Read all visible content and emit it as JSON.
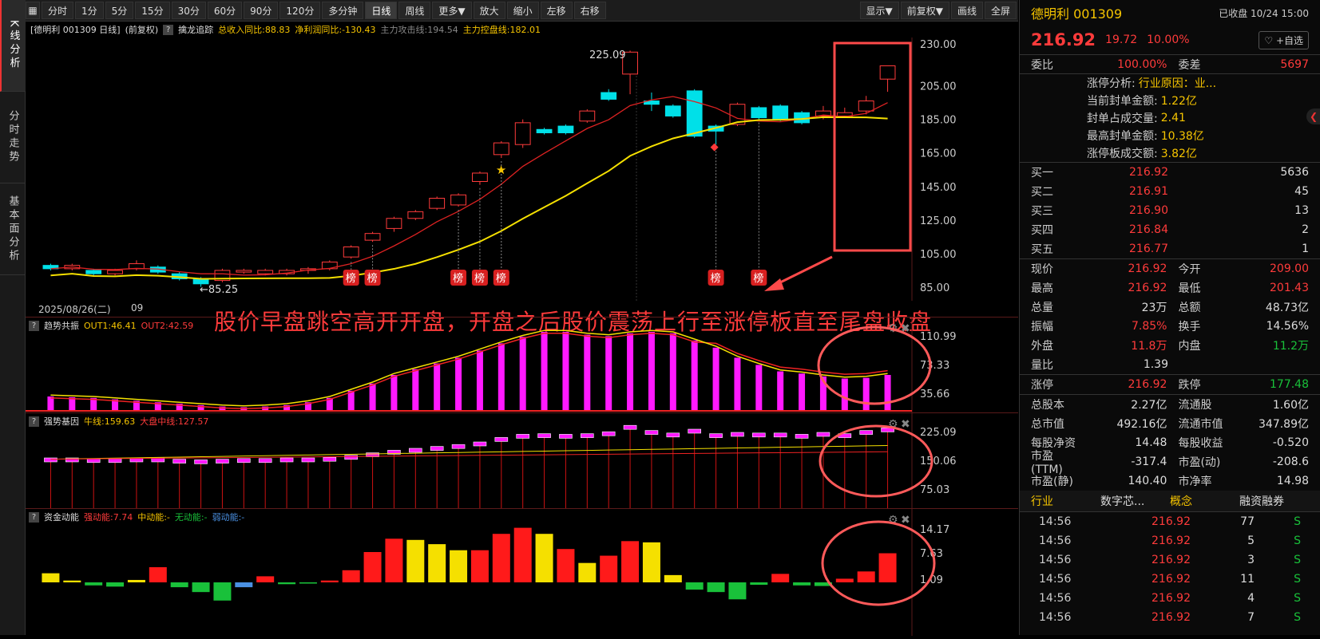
{
  "leftnav": [
    {
      "label": "K线分析",
      "active": true
    },
    {
      "label": "分时走势",
      "active": false
    },
    {
      "label": "基本面分析",
      "active": false
    }
  ],
  "toolbar": {
    "left": [
      "分时",
      "1分",
      "5分",
      "15分",
      "30分",
      "60分",
      "90分",
      "120分",
      "多分钟",
      "日线",
      "周线",
      "更多▼",
      "放大",
      "缩小",
      "左移",
      "右移"
    ],
    "active": "日线",
    "right": [
      "显示▼",
      "前复权▼",
      "画线",
      "全屏"
    ]
  },
  "infobar": {
    "stock": "[德明利 001309 日线]",
    "adjust": "(前复权)",
    "indicator": "擒龙追踪",
    "revenue": "总收入同比:88.83",
    "profit": "净利润同比:-130.43",
    "attack": "主力攻击线:194.54",
    "control": "主力控盘线:182.01"
  },
  "main_axis": [
    "230.00",
    "205.00",
    "185.00",
    "165.00",
    "145.00",
    "125.00",
    "105.00",
    "85.00"
  ],
  "main_labels": {
    "high": "225.09",
    "low": "85.25"
  },
  "bang_label": "榜",
  "date": {
    "current": "2025/08/26(二)",
    "next": "09"
  },
  "annotation": "股价早盘跳空高开开盘，开盘之后股价震荡上行至涨停板直至尾盘收盘",
  "panel1": {
    "name": "趋势共振",
    "out1": "OUT1:46.41",
    "out2": "OUT2:42.59",
    "axis": [
      "110.99",
      "73.33",
      "35.66"
    ]
  },
  "panel2": {
    "name": "强势基因",
    "niu": "牛线:159.63",
    "dapan": "大盘中线:127.57",
    "axis": [
      "225.09",
      "150.06",
      "75.03"
    ]
  },
  "panel3": {
    "name": "资金动能",
    "strong": "强动能:7.74",
    "mid": "中动能:-",
    "none": "无动能:-",
    "weak": "弱动能:-",
    "axis": [
      "14.17",
      "7.63",
      "1.09"
    ]
  },
  "quote": {
    "title": "德明利 001309",
    "status": "已收盘 10/24 15:00",
    "price": "216.92",
    "change": "19.72",
    "pct": "10.00%",
    "fav": "+自选",
    "weibi_label": "委比",
    "weibi": "100.00%",
    "weicha_label": "委差",
    "weicha": "5697",
    "limit": [
      {
        "label": "涨停分析:",
        "value": "行业原因：业..."
      },
      {
        "label": "当前封单金额:",
        "value": "1.22亿"
      },
      {
        "label": "封单占成交量:",
        "value": "2.41"
      },
      {
        "label": "最高封单金额:",
        "value": "10.38亿"
      },
      {
        "label": "涨停板成交额:",
        "value": "3.82亿"
      }
    ],
    "bids": [
      {
        "label": "买一",
        "price": "216.92",
        "vol": "5636"
      },
      {
        "label": "买二",
        "price": "216.91",
        "vol": "45"
      },
      {
        "label": "买三",
        "price": "216.90",
        "vol": "13"
      },
      {
        "label": "买四",
        "price": "216.84",
        "vol": "2"
      },
      {
        "label": "买五",
        "price": "216.77",
        "vol": "1"
      }
    ],
    "stats1": [
      [
        {
          "l": "现价",
          "v": "216.92",
          "c": "red"
        },
        {
          "l": "今开",
          "v": "209.00",
          "c": "red"
        }
      ],
      [
        {
          "l": "最高",
          "v": "216.92",
          "c": "red"
        },
        {
          "l": "最低",
          "v": "201.43",
          "c": "red"
        }
      ],
      [
        {
          "l": "总量",
          "v": "23万",
          "c": "white"
        },
        {
          "l": "总额",
          "v": "48.73亿",
          "c": "white"
        }
      ],
      [
        {
          "l": "振幅",
          "v": "7.85%",
          "c": "red"
        },
        {
          "l": "换手",
          "v": "14.56%",
          "c": "white"
        }
      ],
      [
        {
          "l": "外盘",
          "v": "11.8万",
          "c": "red"
        },
        {
          "l": "内盘",
          "v": "11.2万",
          "c": "green"
        }
      ],
      [
        {
          "l": "量比",
          "v": "1.39",
          "c": "white"
        }
      ]
    ],
    "stats2": [
      [
        {
          "l": "涨停",
          "v": "216.92",
          "c": "red"
        },
        {
          "l": "跌停",
          "v": "177.48",
          "c": "green"
        }
      ]
    ],
    "stats3": [
      [
        {
          "l": "总股本",
          "v": "2.27亿",
          "c": "white"
        },
        {
          "l": "流通股",
          "v": "1.60亿",
          "c": "white"
        }
      ],
      [
        {
          "l": "总市值",
          "v": "492.16亿",
          "c": "white"
        },
        {
          "l": "流通市值",
          "v": "347.89亿",
          "c": "white"
        }
      ],
      [
        {
          "l": "每股净资",
          "v": "14.48",
          "c": "white"
        },
        {
          "l": "每股收益",
          "v": "-0.520",
          "c": "white"
        }
      ],
      [
        {
          "l": "市盈(TTM)",
          "v": "-317.4",
          "c": "white"
        },
        {
          "l": "市盈(动)",
          "v": "-208.6",
          "c": "white"
        }
      ],
      [
        {
          "l": "市盈(静)",
          "v": "140.40",
          "c": "white"
        },
        {
          "l": "市净率",
          "v": "14.98",
          "c": "white"
        }
      ]
    ],
    "tabs": [
      "行业",
      "数字芯...",
      "概念",
      "融资融券"
    ],
    "ticks": [
      {
        "t": "14:56",
        "p": "216.92",
        "v": "77",
        "s": "S"
      },
      {
        "t": "14:56",
        "p": "216.92",
        "v": "5",
        "s": "S"
      },
      {
        "t": "14:56",
        "p": "216.92",
        "v": "3",
        "s": "S"
      },
      {
        "t": "14:56",
        "p": "216.92",
        "v": "11",
        "s": "S"
      },
      {
        "t": "14:56",
        "p": "216.92",
        "v": "4",
        "s": "S"
      },
      {
        "t": "14:56",
        "p": "216.92",
        "v": "7",
        "s": "S"
      }
    ]
  }
}
